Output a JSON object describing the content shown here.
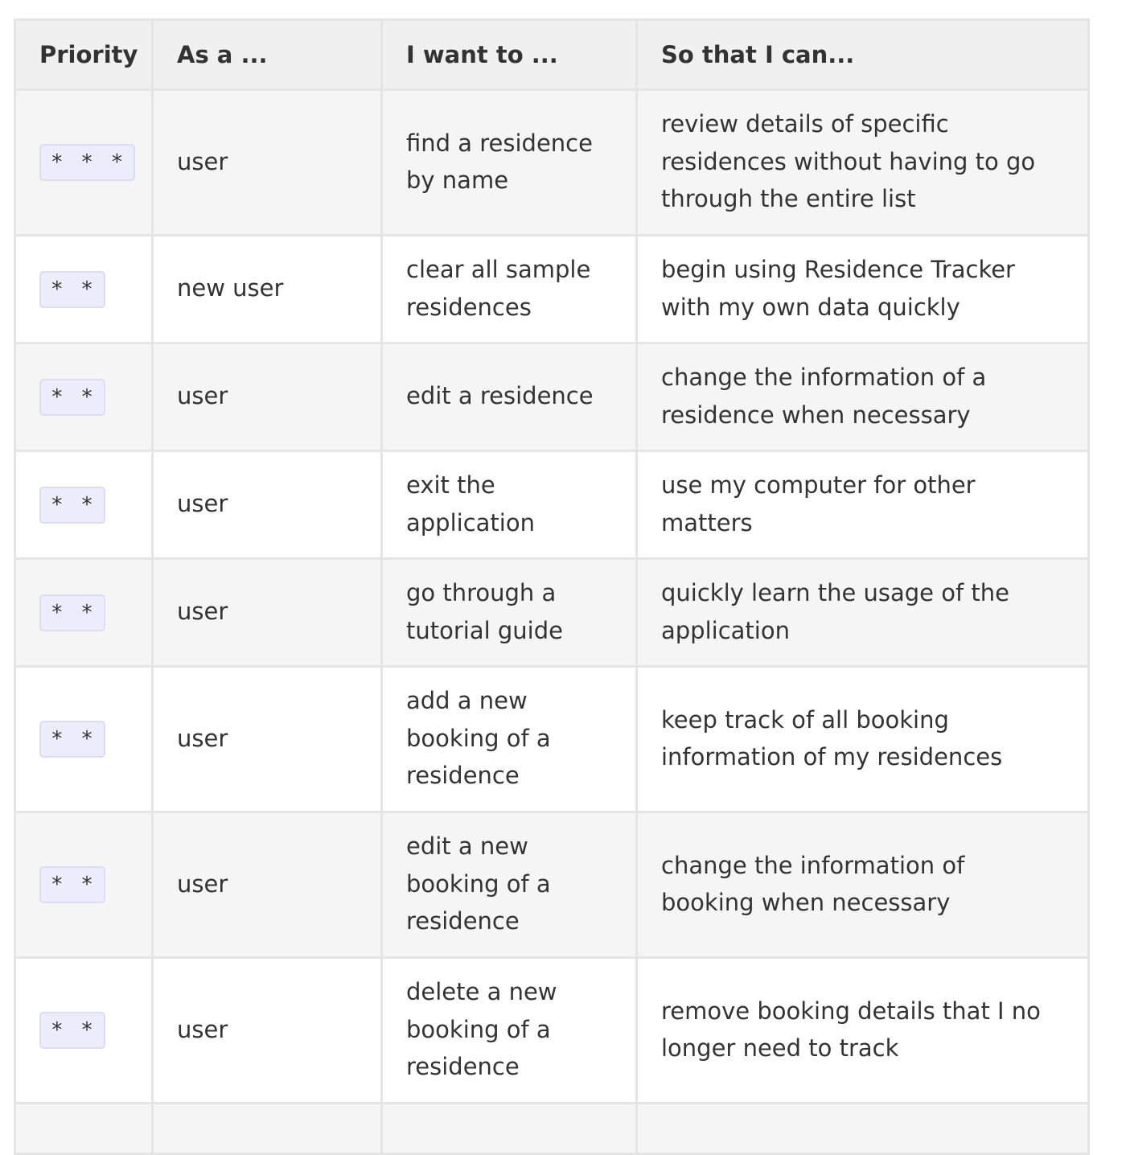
{
  "table": {
    "headers": [
      "Priority",
      "As a ...",
      "I want to ...",
      "So that I can..."
    ],
    "rows": [
      {
        "priority": "* * *",
        "as_a": "user",
        "want": "find a residence by name",
        "so_that": "review details of specific residences without having to go through the entire list"
      },
      {
        "priority": "* *",
        "as_a": "new user",
        "want": "clear all sample residences",
        "so_that": "begin using Residence Tracker with my own data quickly"
      },
      {
        "priority": "* *",
        "as_a": "user",
        "want": "edit a residence",
        "so_that": "change the information of a residence when necessary"
      },
      {
        "priority": "* *",
        "as_a": "user",
        "want": "exit the application",
        "so_that": "use my computer for other matters"
      },
      {
        "priority": "* *",
        "as_a": "user",
        "want": "go through a tutorial guide",
        "so_that": "quickly learn the usage of the application"
      },
      {
        "priority": "* *",
        "as_a": "user",
        "want": "add a new booking of a residence",
        "so_that": "keep track of all booking information of my residences"
      },
      {
        "priority": "* *",
        "as_a": "user",
        "want": "edit a new booking of a residence",
        "so_that": "change the information of booking when necessary"
      },
      {
        "priority": "* *",
        "as_a": "user",
        "want": "delete a new booking of a residence",
        "so_that": "remove booking details that I no longer need to track"
      }
    ]
  }
}
